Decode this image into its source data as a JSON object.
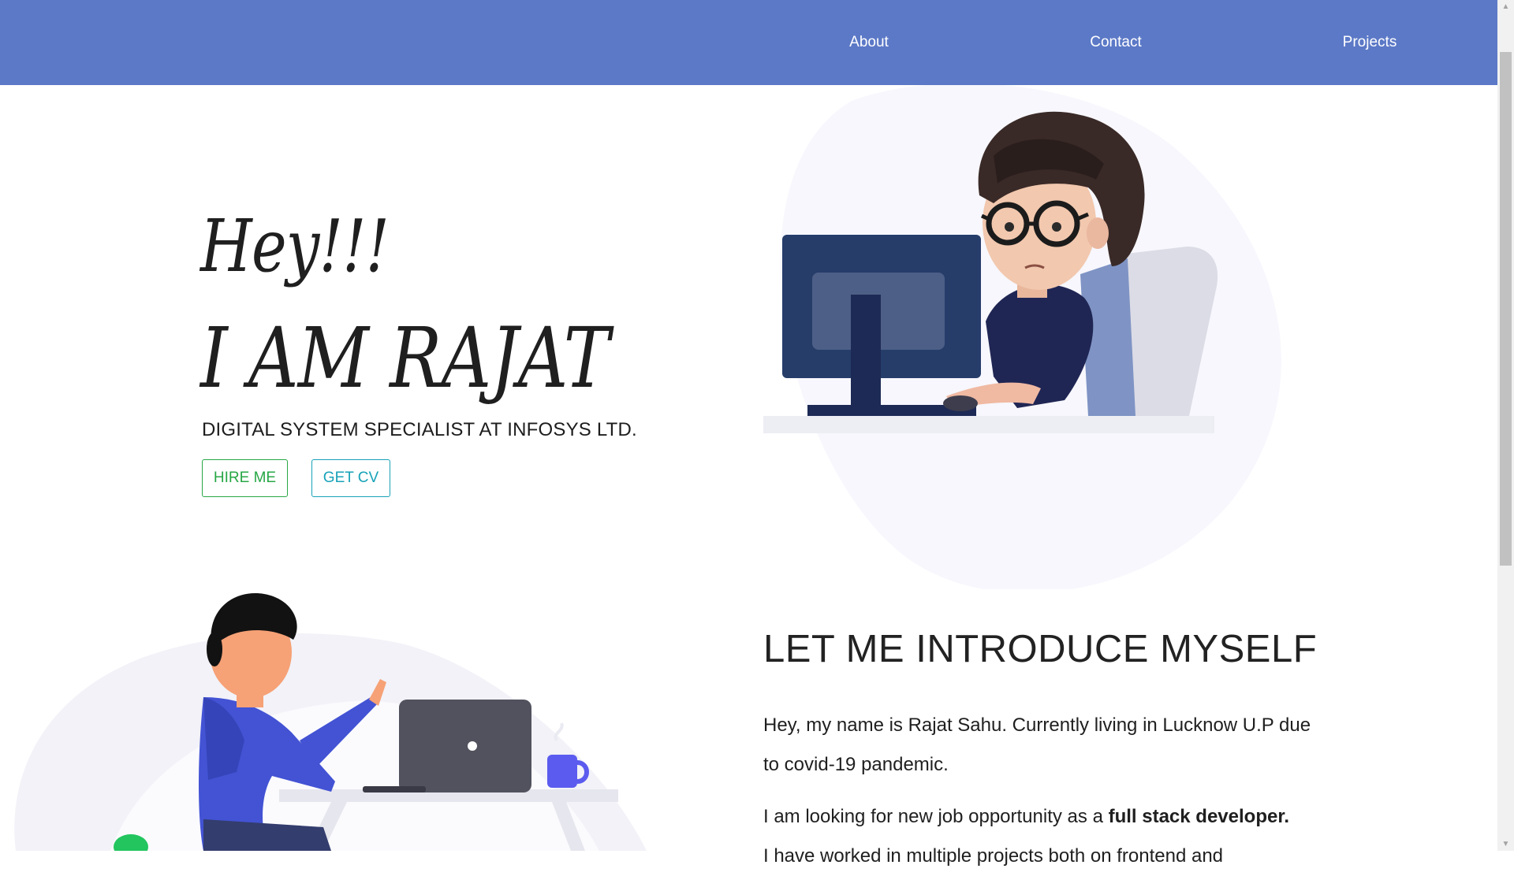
{
  "nav": {
    "items": [
      {
        "label": "About"
      },
      {
        "label": "Contact"
      },
      {
        "label": "Projects"
      }
    ],
    "background": "#5c79c7"
  },
  "hero": {
    "greeting": "Hey!!!",
    "name": "I AM RAJAT",
    "subtitle": "DIGITAL SYSTEM SPECIALIST AT INFOSYS LTD.",
    "hire_button": "HIRE ME",
    "cv_button": "GET CV"
  },
  "intro": {
    "heading": "LET ME INTRODUCE MYSELF",
    "paragraph1": "Hey, my name is Rajat Sahu. Currently living in Lucknow U.P due to covid-19 pandemic.",
    "paragraph2_start": "I am looking for new job opportunity as a ",
    "paragraph2_bold": "full stack developer.",
    "paragraph3_partial": "I have worked in multiple projects both on frontend and"
  },
  "colors": {
    "hire_button": "#28a745",
    "cv_button": "#17a2b8"
  },
  "icons": [
    "developer-illustration",
    "laptop-user-illustration",
    "scroll-up-arrow-icon",
    "scroll-down-arrow-icon"
  ]
}
